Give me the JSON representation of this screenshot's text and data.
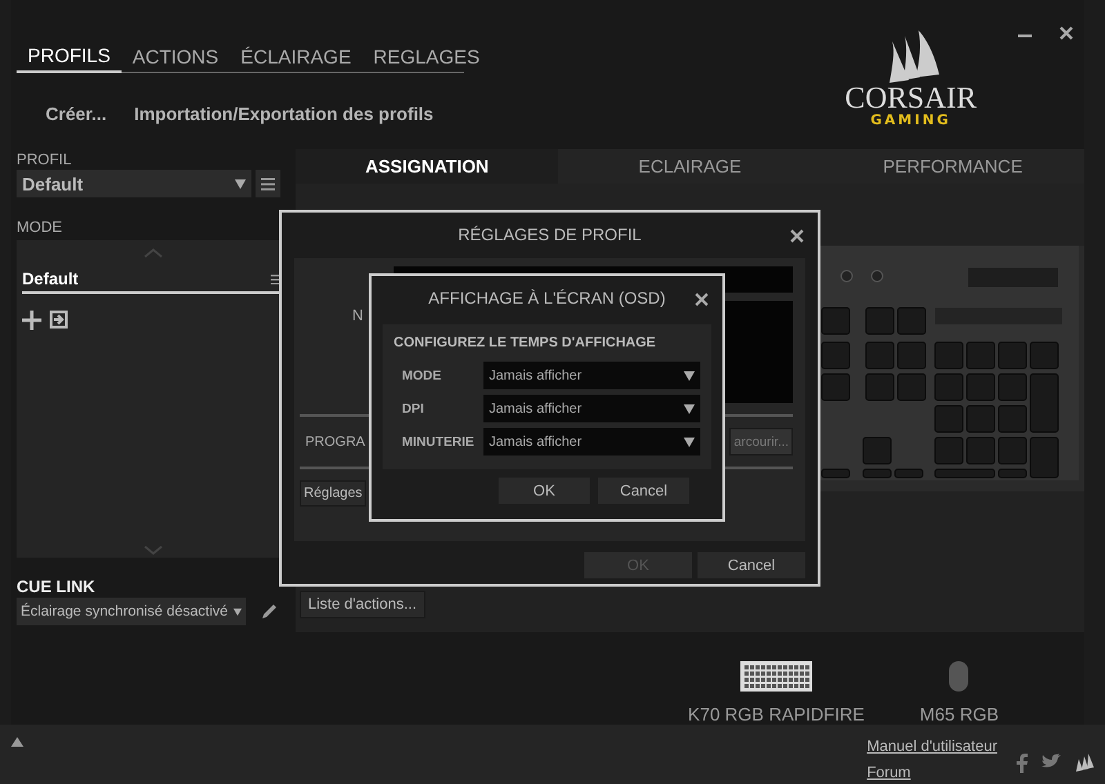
{
  "nav": {
    "tabs": [
      {
        "label": "PROFILS",
        "selected": true
      },
      {
        "label": "ACTIONS",
        "selected": false
      },
      {
        "label": "ÉCLAIRAGE",
        "selected": false
      },
      {
        "label": "REGLAGES",
        "selected": false
      }
    ],
    "actions": [
      "Créer...",
      "Importation/Exportation des profils"
    ]
  },
  "logo": {
    "brand": "CORSAIR",
    "sub": "GAMING"
  },
  "sidebar": {
    "profile_label": "PROFIL",
    "profile_value": "Default",
    "mode_label": "MODE",
    "modes": [
      {
        "label": "Default",
        "selected": true
      }
    ],
    "cue_link_label": "CUE LINK",
    "cue_link_value": "Éclairage synchronisé désactivé"
  },
  "main": {
    "tabs": [
      {
        "label": "ASSIGNATION",
        "selected": true
      },
      {
        "label": "ECLAIRAGE",
        "selected": false
      },
      {
        "label": "PERFORMANCE",
        "selected": false
      }
    ],
    "action_list_button": "Liste d'actions..."
  },
  "profile_dialog": {
    "title": "RÉGLAGES DE PROFIL",
    "name_label": "N",
    "program_label": "PROGRA",
    "browse_button": "arcourir...",
    "settings_button": "Réglages",
    "buttons": [
      {
        "label": "OK",
        "disabled": true
      },
      {
        "label": "Cancel",
        "disabled": false
      }
    ]
  },
  "osd_dialog": {
    "title": "AFFICHAGE À L'ÉCRAN (OSD)",
    "heading": "CONFIGUREZ LE TEMPS D'AFFICHAGE",
    "rows": [
      {
        "label": "MODE",
        "value": "Jamais afficher"
      },
      {
        "label": "DPI",
        "value": "Jamais afficher"
      },
      {
        "label": "MINUTERIE",
        "value": "Jamais afficher"
      }
    ],
    "buttons": [
      {
        "label": "OK",
        "disabled": false
      },
      {
        "label": "Cancel",
        "disabled": false
      }
    ]
  },
  "devices": [
    {
      "kind": "keyboard",
      "name": "K70 RGB RAPIDFIRE"
    },
    {
      "kind": "mouse",
      "name": "M65 RGB"
    }
  ],
  "footer": {
    "links": [
      "Manuel d'utilisateur",
      "Forum"
    ]
  }
}
